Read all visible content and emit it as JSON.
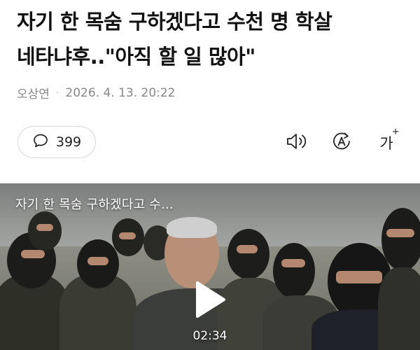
{
  "article": {
    "headline_line1": "자기 한 목숨 구하겠다고 수천 명 학살",
    "headline_line2": "네타냐후..\"아직 할 일 많아\"",
    "author": "오상연",
    "separator": "·",
    "timestamp": "2026. 4. 13. 20:22"
  },
  "toolbar": {
    "comment_icon": "speech-bubble-icon",
    "comment_count": "399",
    "speak_icon": "speaker-icon",
    "translate_icon": "translate-icon",
    "font_size_label": "가",
    "font_size_plus": "+"
  },
  "video": {
    "title": "자기 한 목숨 구하겠다고 수...",
    "duration": "02:34",
    "play_icon": "play-icon"
  },
  "colors": {
    "text_primary": "#111111",
    "text_meta": "#888888",
    "border": "#d9d9d9",
    "overlay_text": "#ffffff"
  }
}
